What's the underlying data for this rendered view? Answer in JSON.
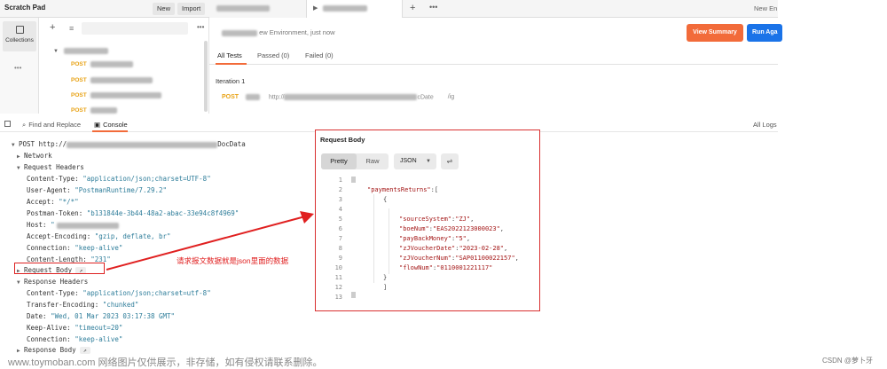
{
  "topbar": {
    "title": "Scratch Pad",
    "new_label": "New",
    "import_label": "Import",
    "add_tab": "+",
    "more": "•••",
    "env_label": "New En"
  },
  "sidebar": {
    "collections_label": "Collections",
    "more": "•••"
  },
  "collections": {
    "add": "+",
    "filter": "≡",
    "more": "•••",
    "items": [
      {
        "method": "POST"
      },
      {
        "method": "POST"
      },
      {
        "method": "POST"
      },
      {
        "method": "POST"
      }
    ]
  },
  "runner": {
    "info_suffix": "ew Environment, just now",
    "view_summary": "View Summary",
    "run_again": "Run Aga",
    "tabs": {
      "all": "All Tests",
      "passed": "Passed (0)",
      "failed": "Failed (0)"
    },
    "iteration": "Iteration 1",
    "iter_method": "POST",
    "iter_url_prefix": "http://",
    "iter_url_mid": "cDate",
    "iter_url_tail": "/ig"
  },
  "console": {
    "find_replace": "Find and Replace",
    "console_tab": "Console",
    "all_logs": "All Logs",
    "request_line": "POST http://",
    "request_line_end": "DocData",
    "network": "Network",
    "request_headers": "Request Headers",
    "req_headers": [
      {
        "k": "Content-Type:",
        "v": "\"application/json;charset=UTF-8\""
      },
      {
        "k": "User-Agent:",
        "v": "\"PostmanRuntime/7.29.2\""
      },
      {
        "k": "Accept:",
        "v": "\"*/*\""
      },
      {
        "k": "Postman-Token:",
        "v": "\"b131844e-3b44-48a2-abac-33e94c8f4969\""
      },
      {
        "k": "Host:",
        "v": "\""
      },
      {
        "k": "Accept-Encoding:",
        "v": "\"gzip, deflate, br\""
      },
      {
        "k": "Connection:",
        "v": "\"keep-alive\""
      },
      {
        "k": "Content-Length:",
        "v": "\"231\""
      }
    ],
    "request_body": "Request Body",
    "response_headers": "Response Headers",
    "resp_headers": [
      {
        "k": "Content-Type:",
        "v": "\"application/json;charset=utf-8\""
      },
      {
        "k": "Transfer-Encoding:",
        "v": "\"chunked\""
      },
      {
        "k": "Date:",
        "v": "\"Wed, 01 Mar 2023 03:17:38 GMT\""
      },
      {
        "k": "Keep-Alive:",
        "v": "\"timeout=20\""
      },
      {
        "k": "Connection:",
        "v": "\"keep-alive\""
      }
    ],
    "response_body": "Response Body",
    "ext_icon": "↗"
  },
  "request_body_panel": {
    "title": "Request Body",
    "pretty": "Pretty",
    "raw": "Raw",
    "format": "JSON",
    "lines": [
      {
        "n": "1",
        "text": ""
      },
      {
        "n": "2",
        "key": "\"paymentsReturns\"",
        "rest": ":["
      },
      {
        "n": "3",
        "text": "{"
      },
      {
        "n": "4",
        "text": ""
      },
      {
        "n": "5",
        "key": "\"sourceSystem\"",
        "rest": ":",
        "val": "\"ZJ\"",
        "tail": ","
      },
      {
        "n": "6",
        "key": "\"boeNum\"",
        "rest": ":",
        "val": "\"EAS2022123000023\"",
        "tail": ","
      },
      {
        "n": "7",
        "key": "\"payBackMoney\"",
        "rest": ":",
        "val": "\"5\"",
        "tail": ","
      },
      {
        "n": "8",
        "key": "\"zJVoucherDate\"",
        "rest": ":",
        "val": "\"2023-02-28\"",
        "tail": ","
      },
      {
        "n": "9",
        "key": "\"zJVoucherNum\"",
        "rest": ":",
        "val": "\"SAP01100022157\"",
        "tail": ","
      },
      {
        "n": "10",
        "key": "\"flowNum\"",
        "rest": ":",
        "val": "\"0110001221117\"",
        "tail": ""
      },
      {
        "n": "11",
        "text": "}"
      },
      {
        "n": "12",
        "text": "]"
      },
      {
        "n": "13",
        "text": ""
      }
    ]
  },
  "annotation": {
    "text": "请求报文数据就是json里面的数据",
    "color": "#e02020"
  },
  "watermark": "www.toymoban.com 网络图片仅供展示，非存储，如有侵权请联系删除。",
  "credit": "CSDN @萝卜牙"
}
